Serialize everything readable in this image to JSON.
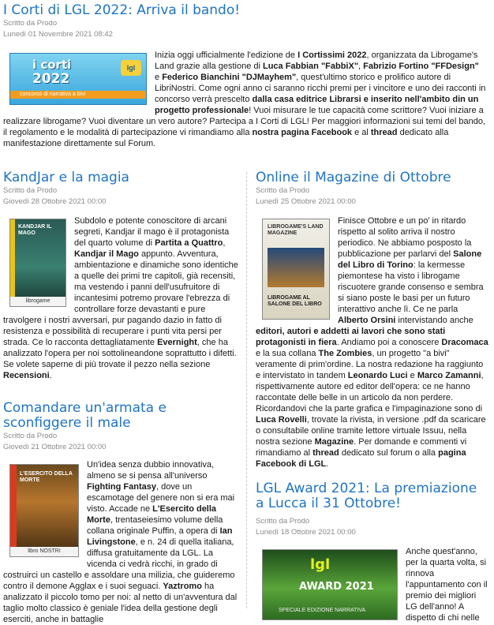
{
  "articles": [
    {
      "title": "I Corti di LGL 2022: Arriva il bando!",
      "author": "Scritto da Prodo",
      "date": "Lunedì 01 Novembre 2021 08:42",
      "image": {
        "line1": "i corti",
        "line2": "2022",
        "badge": "lgl",
        "caption": "concorso di narrativa a bivi"
      },
      "body": [
        {
          "t": "Inizia oggi ufficialmente l'edizione de "
        },
        {
          "t": "I Cortissimi 2022",
          "b": true
        },
        {
          "t": ", organizzata da Librogame's Land grazie alla gestione di "
        },
        {
          "t": "Luca Fabbian \"FabbiX\"",
          "b": true
        },
        {
          "t": ", "
        },
        {
          "t": "Fabrizio Fortino \"FFDesign\"",
          "b": true
        },
        {
          "t": " e "
        },
        {
          "t": "Federico Bianchini \"DJMayhem\"",
          "b": true
        },
        {
          "t": ", quest'ultimo storico e prolifico autore di LibriNostri. Come ogni anno ci saranno ricchi premi per i vincitore e uno dei racconti in concorso verrà prescelto "
        },
        {
          "t": "dalla casa editrice Librarsi e inserito nell'ambito din un progetto professionale",
          "b": true
        },
        {
          "t": "! Vuoi misurare le tue capacità come scrittore? Vuoi iniziare a realizzare librogame? Vuoi diventare un vero autore? Partecipa a I Corti di LGL! Per maggiori informazioni sui temi del bando, il regolamento e le modalità di partecipazione vi rimandiamo alla "
        },
        {
          "t": "nostra pagina Facebook",
          "b": true
        },
        {
          "t": " e al "
        },
        {
          "t": "thread",
          "b": true
        },
        {
          "t": " dedicato alla manifestazione direttamente sul Forum."
        }
      ]
    },
    {
      "title": "KandJar e la magia",
      "author": "Scritto da Prodo",
      "date": "Giovedì 28 Ottobre 2021 00:00",
      "image": {
        "title": "KANDJAR IL MAGO",
        "footer": "librogame"
      },
      "body": [
        {
          "t": "Subdolo e potente conoscitore di arcani segreti, Kandjar il mago è il protagonista del quarto volume di "
        },
        {
          "t": "Partita a Quattro",
          "b": true
        },
        {
          "t": ", "
        },
        {
          "t": "Kandjar il Mago",
          "b": true
        },
        {
          "t": " appunto. Avventura, ambientazione e dinamiche sono identiche a quelle dei primi tre capitoli, già recensiti, ma vestendo i panni dell'usufruitore di incantesimi potremo provare l'ebrezza di controllare forze devastanti  e pure travolgere i nostri avversari, pur pagando dazio in fatto di resistenza e possibilità di recuperare i punti vita persi per strada. Ce lo racconta dettagliatamente "
        },
        {
          "t": "Evernight",
          "b": true
        },
        {
          "t": ", che ha analizzato l'opera per noi sottolineandone soprattutto i difetti. Se volete saperne di più trovate il pezzo nella sezione "
        },
        {
          "t": "Recensioni",
          "b": true
        },
        {
          "t": "."
        }
      ]
    },
    {
      "title": "Comandare un'armata e sconfiggere il male",
      "author": "Scritto da Prodo",
      "date": "Giovedì 21 Ottobre 2021 00:00",
      "image": {
        "title": "L'ESERCITO DELLA MORTE",
        "footer": "libro NOSTRI"
      },
      "body": [
        {
          "t": "Un'idea senza dubbio innovativa, almeno se si pensa all'universo "
        },
        {
          "t": "Fighting Fantasy",
          "b": true
        },
        {
          "t": ", dove un escamotage del genere non si era mai visto. Accade ne "
        },
        {
          "t": "L'Esercito della Morte",
          "b": true
        },
        {
          "t": ", trentaseiesimo volume della collana originale Puffin, a opera di "
        },
        {
          "t": "Ian Livingstone",
          "b": true
        },
        {
          "t": ", e n. 24 di quella italiana, diffusa gratuitamente da LGL. La vicenda ci vedrà ricchi, in grado di costruirci un castello e assoldare una milizia, che guideremo contro il demone Agglax e i suoi seguaci. "
        },
        {
          "t": "Yaztromo",
          "b": true
        },
        {
          "t": " ha analizzato il piccolo tomo per noi: al netto di un'avventura dal taglio molto classico è geniale l'idea della gestione degli eserciti, anche in battaglie"
        }
      ]
    },
    {
      "title": "Online il Magazine di Ottobre",
      "author": "Scritto da Prodo",
      "date": "Lunedì 25 Ottobre 2021 00:00",
      "image": {
        "title": "LIBROGAME'S LAND MAGAZINE",
        "caption": "LIBROGAME AL SALONE DEL LIBRO"
      },
      "body": [
        {
          "t": "Finisce Ottobre e un po' in ritardo rispetto al solito arriva il nostro periodico. Ne abbiamo posposto la pubblicazione per parlarvi del "
        },
        {
          "t": "Salone del Libro di Torino",
          "b": true
        },
        {
          "t": ": la kermesse piemontese  ha visto i librogame riscuotere grande consenso e sembra si siano poste le basi per un futuro interattivo anche lì. Ce ne parla "
        },
        {
          "t": "Alberto Orsini",
          "b": true
        },
        {
          "t": " intervistando anche "
        },
        {
          "t": "editori, autori e addetti ai lavori che sono stati protagonisti in fiera",
          "b": true
        },
        {
          "t": ". Andiamo poi a conoscere "
        },
        {
          "t": "Dracomaca",
          "b": true
        },
        {
          "t": " e la sua collana "
        },
        {
          "t": "The Zombies",
          "b": true
        },
        {
          "t": ", un progetto \"a bivi\" veramente di prim'ordine. La nostra redazione ha raggiunto e intervistato in tandem "
        },
        {
          "t": "Leonardo Luci",
          "b": true
        },
        {
          "t": " e "
        },
        {
          "t": "Marco Zamanni",
          "b": true
        },
        {
          "t": ", rispettivamente autore ed editor dell'opera: ce ne hanno raccontate delle belle in un articolo da non perdere. Ricordandovi che la parte grafica e l'impaginazione sono di "
        },
        {
          "t": "Luca Rovelli",
          "b": true
        },
        {
          "t": ", trovate la rivista, in versione .pdf da scaricare o consultabile online tramite lettore virtuale Issuu, nella nostra sezione "
        },
        {
          "t": "Magazine",
          "b": true
        },
        {
          "t": ". Per domande e commenti vi rimandiamo al "
        },
        {
          "t": "thread",
          "b": true
        },
        {
          "t": " dedicato sul forum o alla "
        },
        {
          "t": "pagina Facebook di LGL",
          "b": true
        },
        {
          "t": "."
        }
      ]
    },
    {
      "title": "LGL Award 2021: La premiazione a Lucca il 31 Ottobre!",
      "author": "Scritto da Prodo",
      "date": "Lunedì 18 Ottobre 2021 00:00",
      "image": {
        "line1": "lgl",
        "line2": "AWARD 2021",
        "caption": "SPECIALE EDIZIONE NARRATIVA"
      },
      "body": [
        {
          "t": "Anche quest'anno, per la quarta volta, si rinnova l'appuntamento con il premio dei migliori LG dell'anno! A dispetto di chi nelle"
        }
      ]
    }
  ]
}
